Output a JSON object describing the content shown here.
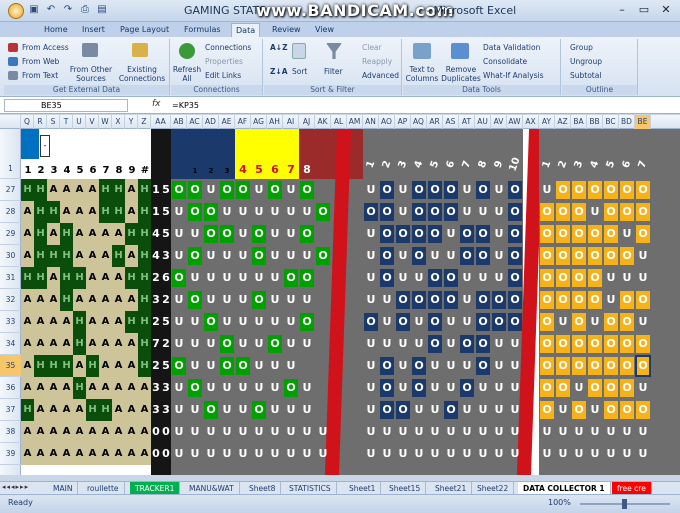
{
  "window": {
    "title": "GAMING STATS",
    "app": "- Microsoft Excel",
    "watermark": "www.BANDICAM.com"
  },
  "ribbon_tabs": [
    "Home",
    "Insert",
    "Page Layout",
    "Formulas",
    "Data",
    "Review",
    "View"
  ],
  "active_tab": "Data",
  "ribbon": {
    "get_external": {
      "label": "Get External Data",
      "from_access": "From Access",
      "from_web": "From Web",
      "from_text": "From Text",
      "other_sources": "From Other Sources",
      "existing": "Existing Connections"
    },
    "connections": {
      "label": "Connections",
      "refresh": "Refresh All",
      "connections": "Connections",
      "properties": "Properties",
      "edit_links": "Edit Links"
    },
    "sort_filter": {
      "label": "Sort & Filter",
      "sort": "Sort",
      "filter": "Filter",
      "clear": "Clear",
      "reapply": "Reapply",
      "advanced": "Advanced"
    },
    "data_tools": {
      "label": "Data Tools",
      "text_to_columns": "Text to Columns",
      "remove_duplicates": "Remove Duplicates",
      "data_validation": "Data Validation",
      "consolidate": "Consolidate",
      "what_if": "What-If Analysis"
    },
    "outline": {
      "label": "Outline",
      "group": "Group",
      "ungroup": "Ungroup",
      "subtotal": "Subtotal"
    }
  },
  "formula_bar": {
    "name_box": "BE35",
    "fx": "fx",
    "formula": "=KP35"
  },
  "columns": [
    "Q",
    "R",
    "S",
    "T",
    "U",
    "V",
    "W",
    "X",
    "Y",
    "Z",
    "AA",
    "AB",
    "AC",
    "AD",
    "AE",
    "AF",
    "AG",
    "AH",
    "AI",
    "AJ",
    "AK",
    "AL",
    "AM",
    "AN",
    "AO",
    "AP",
    "AQ",
    "AR",
    "AS",
    "AT",
    "AU",
    "AV",
    "AW",
    "AX",
    "AY",
    "AZ",
    "BA",
    "BB",
    "BC",
    "BD",
    "BE"
  ],
  "selected_col": "BE",
  "rows": [
    "1",
    "27",
    "28",
    "29",
    "30",
    "31",
    "32",
    "33",
    "34",
    "35",
    "36",
    "37",
    "38",
    "39"
  ],
  "selected_row": "35",
  "header_row": {
    "dropdown": "-",
    "aa_nums": [
      "1",
      "2",
      "3",
      "4",
      "5",
      "6",
      "7",
      "8",
      "9",
      "#"
    ],
    "ac_nums": [
      "1",
      "2",
      "3"
    ],
    "yellow_nums": [
      "4",
      "5",
      "6",
      "7"
    ],
    "red_num": "8",
    "blue_nums": [
      "1",
      "2",
      "3",
      "4",
      "5",
      "6",
      "7",
      "8",
      "9",
      "10"
    ],
    "orange_nums": [
      "1",
      "2",
      "3",
      "4",
      "5",
      "6",
      "7"
    ]
  },
  "ha_grid": [
    "HHAAAAHHAH",
    "AHHAAAHHAH",
    "AHAHAAAAHH",
    "AHHHAAAHAH",
    "HHAHHAAAHH",
    "AAAHAAAAAH",
    "AAAAHAAAHH",
    "AAAAHAAAAH",
    "AHHHAHAAAH",
    "AAAAHAAAAA",
    "HAAAAHHAAA",
    "AAAAAAAAAA",
    "AAAAAAAAAA"
  ],
  "scores": [
    [
      "1",
      "5"
    ],
    [
      "1",
      "5"
    ],
    [
      "4",
      "5"
    ],
    [
      "4",
      "3"
    ],
    [
      "2",
      "6"
    ],
    [
      "3",
      "2"
    ],
    [
      "2",
      "5"
    ],
    [
      "7",
      "2"
    ],
    [
      "2",
      "5"
    ],
    [
      "3",
      "3"
    ],
    [
      "3",
      "3"
    ],
    [
      "0",
      "0"
    ],
    [
      "0",
      "0"
    ]
  ],
  "green_grid": [
    "OOUOOUOUO",
    "UOOUUUUUUO",
    "UUOOUOUUO",
    "UOUUUOUUUO",
    "OUUUUUUOO",
    "UOUUUOUUU",
    "UUOUUUUUO",
    "UUUOUUOUU",
    "OUUOOUUU",
    "UOUUUUUOU",
    "UUOUUOUUU",
    "UUUUUUUUUU",
    "UUUUUUUUUU"
  ],
  "blue_grid": [
    "UOUOOOUOUO",
    "OOUOOOUUUO",
    "UOOOOUOOUO",
    "UOUOUUOOUO",
    "UOUUOOUUUO",
    "UUOOOOUOOO",
    "OUOUOUUOOO",
    "UUUUOUOOUU",
    "UOUOUUUOUU",
    "UOUOUUOUUU",
    "UOOUUOUUUU",
    "UUUUUUUUUU",
    "UUUUUUUUUU"
  ],
  "orange_grid": [
    "UOOOOOOO",
    "OOOUOOOU",
    "OOOOOUOU",
    "OOOOOOUO",
    "OOOOUUUO",
    "OOOOUOOO",
    "OUOUOOUO",
    "OOOOOOOO",
    "OOOOOOOU",
    "OOUOOOUO",
    "OUOUOOOO",
    "UUUUUUUU",
    "UUUUUUUU"
  ],
  "sheet_tabs": [
    "MAIN",
    "roullette",
    "TRACKER1",
    "MANU&WAT",
    "Sheet8",
    "STATISTICS",
    "Sheet1",
    "Sheet15",
    "Sheet21",
    "Sheet22",
    "DATA COLLECTOR 1",
    "free cre"
  ],
  "active_sheet": "DATA COLLECTOR 1",
  "status": {
    "ready": "Ready",
    "zoom": "100%"
  },
  "colors": {
    "dark_green": "#0b4d0b",
    "tan": "#cdc49a",
    "green": "#00a000",
    "gray": "#6e6e6e",
    "navy": "#1b3a6b",
    "red": "#d0121b",
    "orange": "#f6b21b",
    "yellow": "#ffff00",
    "maroon": "#9b2a2a",
    "black": "#151515"
  }
}
